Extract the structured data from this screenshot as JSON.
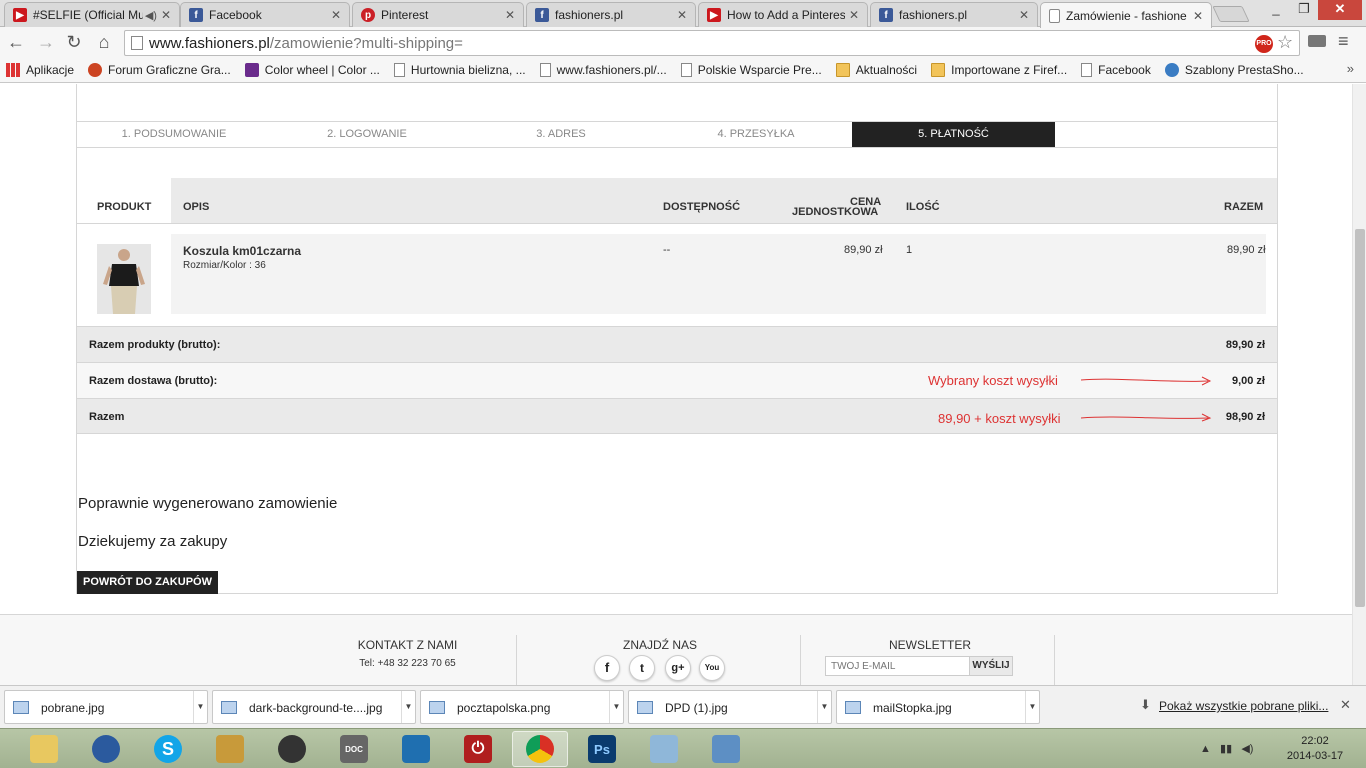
{
  "browser": {
    "tabs": [
      {
        "title": "#SELFIE (Official Mu",
        "icon": "youtube-icon",
        "color": "#cc181e",
        "audio": true
      },
      {
        "title": "Facebook",
        "icon": "facebook-icon",
        "color": "#3b5998"
      },
      {
        "title": "Pinterest",
        "icon": "pinterest-icon",
        "color": "#cb2027"
      },
      {
        "title": "fashioners.pl",
        "icon": "facebook-icon",
        "color": "#3b5998"
      },
      {
        "title": "How to Add a Pinteres",
        "icon": "youtube-icon",
        "color": "#cc181e"
      },
      {
        "title": "fashioners.pl",
        "icon": "facebook-icon",
        "color": "#3b5998"
      },
      {
        "title": "Zamówienie - fashione",
        "icon": "page-icon",
        "color": "#ffffff",
        "active": true
      }
    ],
    "url": {
      "host": "www.fashioners.pl",
      "path": "/zamowienie?multi-shipping="
    },
    "bookmarks": [
      {
        "label": "Aplikacje",
        "icon": "apps-icon"
      },
      {
        "label": "Forum Graficzne Gra...",
        "icon": "forum-icon"
      },
      {
        "label": "Color wheel | Color ...",
        "icon": "color-wheel-icon"
      },
      {
        "label": "Hurtownia bielizna, ...",
        "icon": "page-icon"
      },
      {
        "label": "www.fashioners.pl/...",
        "icon": "page-icon"
      },
      {
        "label": "Polskie Wsparcie Pre...",
        "icon": "page-icon"
      },
      {
        "label": "Aktualności",
        "icon": "folder-icon"
      },
      {
        "label": "Importowane z Firef...",
        "icon": "folder-icon"
      },
      {
        "label": "Facebook",
        "icon": "page-icon"
      },
      {
        "label": "Szablony PrestaSho...",
        "icon": "prestashop-icon"
      }
    ],
    "bookmarks_more": "»"
  },
  "checkout": {
    "steps": [
      "1. PODSUMOWANIE",
      "2. LOGOWANIE",
      "3. ADRES",
      "4. PRZESYŁKA",
      "5. PŁATNOŚĆ"
    ],
    "active_step": 4,
    "headers": {
      "product": "Produkt",
      "description": "Opis",
      "availability": "Dostępność",
      "unit_price_1": "Cena",
      "unit_price_2": "jednostkowa",
      "quantity": "Ilość",
      "total": "Razem"
    },
    "item": {
      "name": "Koszula km01czarna",
      "attributes": "Rozmiar/Kolor : 36",
      "availability": "--",
      "unit_price": "89,90 zł",
      "quantity": "1",
      "total": "89,90 zł"
    },
    "summary": [
      {
        "label": "Razem produkty (brutto):",
        "value": "89,90 zł",
        "note": ""
      },
      {
        "label": "Razem dostawa (brutto):",
        "value": "9,00 zł",
        "note": "Wybrany koszt wysyłki"
      },
      {
        "label": "Razem",
        "value": "98,90 zł",
        "note": "89,90 + koszt wysyłki"
      }
    ],
    "messages": [
      "Poprawnie wygenerowano zamowienie",
      "Dziekujemy za zakupy"
    ],
    "back_button": "POWRÓT DO ZAKUPÓW"
  },
  "footer": {
    "contact_title": "KONTAKT Z NAMI",
    "contact_phone": "Tel: +48 32 223 70 65",
    "social_title": "ZNAJDŹ NAS",
    "social": [
      "facebook-icon",
      "twitter-icon",
      "google-plus-icon",
      "youtube-icon"
    ],
    "newsletter_title": "NEWSLETTER",
    "newsletter_placeholder": "TWÓJ E-MAIL",
    "newsletter_button": "WYŚLIJ"
  },
  "downloads": {
    "items": [
      "pobrane.jpg",
      "dark-background-te....jpg",
      "pocztapolska.png",
      "DPD (1).jpg",
      "mailStopka.jpg"
    ],
    "show_all": "Pokaż wszystkie pobrane pliki..."
  },
  "taskbar": {
    "apps": [
      "file-explorer-icon",
      "thunderbird-icon",
      "skype-icon",
      "media-icon",
      "speaker-icon",
      "document-icon",
      "settings-icon",
      "power-icon",
      "chrome-icon",
      "photoshop-icon",
      "notepad-icon",
      "image-viewer-icon"
    ],
    "time": "22:02",
    "date": "2014-03-17"
  },
  "colors": {
    "accent_dark": "#222222",
    "annotation_red": "#dd3333"
  }
}
